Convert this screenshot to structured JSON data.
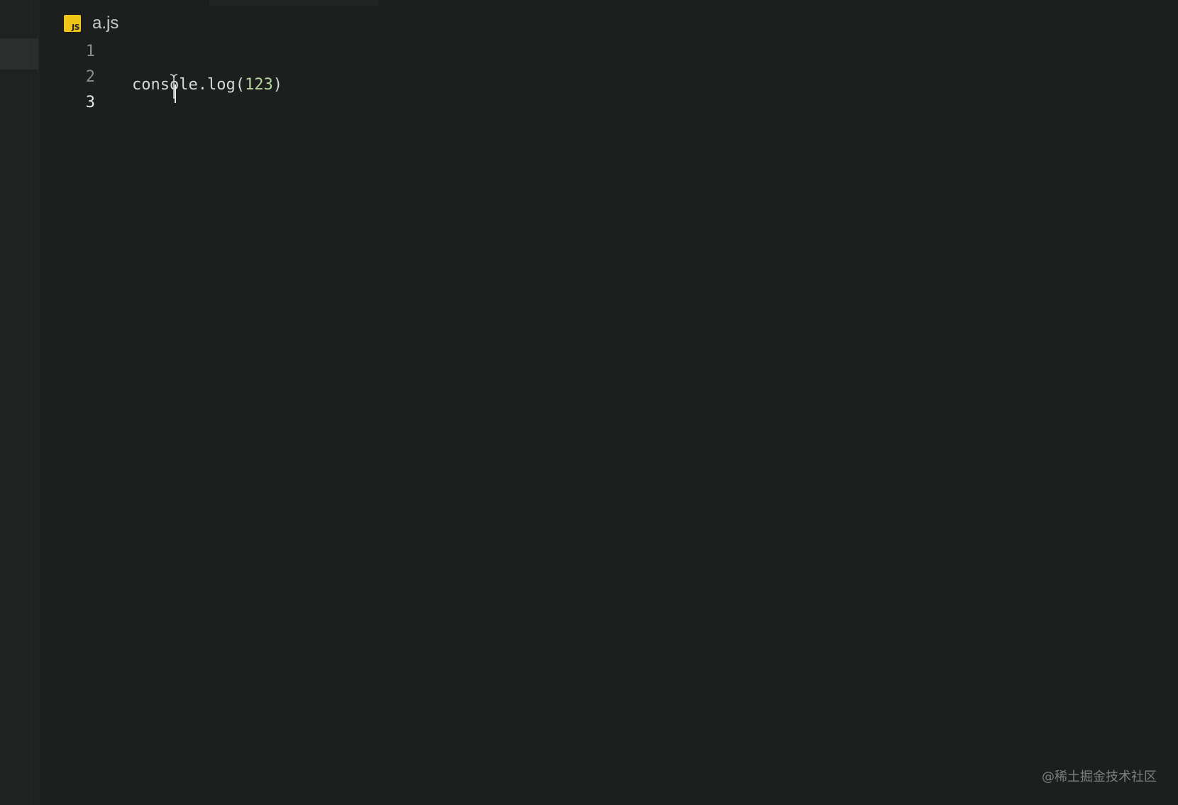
{
  "tab": {
    "icon": "javascript-file-icon",
    "icon_text": "JS",
    "filename": "a.js"
  },
  "editor": {
    "lines": [
      {
        "number": "1",
        "code": ""
      },
      {
        "number": "2",
        "code": ""
      },
      {
        "number": "3",
        "code_ident": "console.log(",
        "code_num": "123",
        "code_tail": ")"
      }
    ],
    "active_line": "3"
  },
  "watermark": "@稀土掘金技术社区",
  "colors": {
    "background": "#1c1f1d",
    "js_icon": "#f0c419",
    "number_literal": "#b8d7a3"
  }
}
